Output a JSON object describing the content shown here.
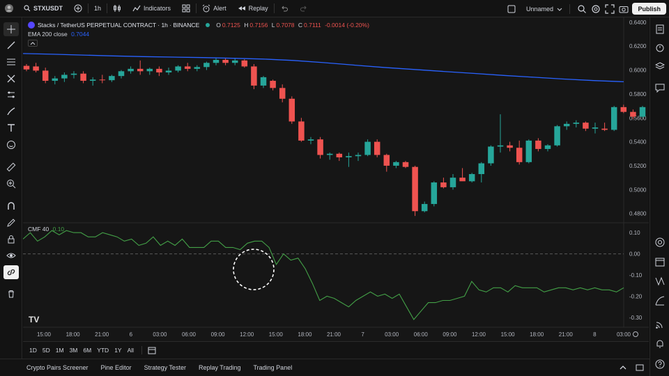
{
  "toolbar": {
    "symbol": "STXUSDT",
    "interval": "1h",
    "indicators_label": "Indicators",
    "alert_label": "Alert",
    "replay_label": "Replay",
    "layout_name": "Unnamed",
    "publish_label": "Publish"
  },
  "legend": {
    "title": "Stacks / TetherUS PERPETUAL CONTRACT · 1h · BINANCE",
    "o_label": "O",
    "o_value": "0.7125",
    "h_label": "H",
    "h_value": "0.7156",
    "l_label": "L",
    "l_value": "0.7078",
    "c_label": "C",
    "c_value": "0.7111",
    "change": "-0.0014 (-0.20%)",
    "ema_label": "EMA 200 close",
    "ema_value": "0.7044",
    "cmf_label": "CMF 40",
    "cmf_value": "0.10"
  },
  "colors": {
    "up": "#26a69a",
    "down": "#ef5350",
    "ema": "#2962ff",
    "cmf": "#43a047",
    "background": "#161616"
  },
  "range_buttons": [
    "1D",
    "5D",
    "1M",
    "3M",
    "6M",
    "YTD",
    "1Y",
    "All"
  ],
  "bottom_tabs": [
    "Crypto Pairs Screener",
    "Pine Editor",
    "Strategy Tester",
    "Replay Trading",
    "Trading Panel"
  ],
  "chart_data": {
    "type": "candlestick",
    "price_axis_ticks": [
      "0.6400",
      "0.6200",
      "0.6000",
      "0.5800",
      "0.5600",
      "0.5400",
      "0.5200",
      "0.5000",
      "0.4800"
    ],
    "price_ylim": [
      0.474,
      0.644
    ],
    "cmf_axis_ticks": [
      "0.10",
      "0.00",
      "-0.10",
      "-0.20",
      "-0.30"
    ],
    "cmf_ylim": [
      -0.33,
      0.13
    ],
    "time_ticks": [
      "15:00",
      "18:00",
      "21:00",
      "6",
      "03:00",
      "06:00",
      "09:00",
      "12:00",
      "15:00",
      "18:00",
      "21:00",
      "7",
      "03:00",
      "06:00",
      "09:00",
      "12:00",
      "15:00",
      "18:00",
      "21:00",
      "8",
      "03:00"
    ],
    "candles": [
      [
        0.6035,
        0.605,
        0.599,
        0.6005
      ],
      [
        0.603,
        0.606,
        0.598,
        0.5995
      ],
      [
        0.5995,
        0.602,
        0.589,
        0.591
      ],
      [
        0.591,
        0.595,
        0.588,
        0.593
      ],
      [
        0.593,
        0.598,
        0.59,
        0.596
      ],
      [
        0.596,
        0.599,
        0.593,
        0.597
      ],
      [
        0.597,
        0.599,
        0.589,
        0.591
      ],
      [
        0.591,
        0.594,
        0.587,
        0.592
      ],
      [
        0.592,
        0.596,
        0.589,
        0.5915
      ],
      [
        0.5915,
        0.596,
        0.59,
        0.595
      ],
      [
        0.595,
        0.6,
        0.593,
        0.599
      ],
      [
        0.599,
        0.603,
        0.597,
        0.601
      ],
      [
        0.601,
        0.608,
        0.596,
        0.599
      ],
      [
        0.599,
        0.602,
        0.596,
        0.601
      ],
      [
        0.601,
        0.603,
        0.595,
        0.598
      ],
      [
        0.598,
        0.602,
        0.596,
        0.5995
      ],
      [
        0.5995,
        0.604,
        0.598,
        0.603
      ],
      [
        0.603,
        0.606,
        0.599,
        0.601
      ],
      [
        0.601,
        0.604,
        0.599,
        0.6025
      ],
      [
        0.6025,
        0.607,
        0.6,
        0.606
      ],
      [
        0.606,
        0.61,
        0.604,
        0.6085
      ],
      [
        0.6085,
        0.61,
        0.604,
        0.606
      ],
      [
        0.606,
        0.6095,
        0.604,
        0.608
      ],
      [
        0.608,
        0.609,
        0.602,
        0.603
      ],
      [
        0.603,
        0.605,
        0.584,
        0.587
      ],
      [
        0.587,
        0.595,
        0.585,
        0.594
      ],
      [
        0.591,
        0.592,
        0.583,
        0.585
      ],
      [
        0.585,
        0.588,
        0.573,
        0.576
      ],
      [
        0.576,
        0.578,
        0.555,
        0.557
      ],
      [
        0.557,
        0.56,
        0.54,
        0.541
      ],
      [
        0.541,
        0.544,
        0.538,
        0.542
      ],
      [
        0.542,
        0.544,
        0.526,
        0.529
      ],
      [
        0.529,
        0.531,
        0.525,
        0.53
      ],
      [
        0.53,
        0.531,
        0.524,
        0.527
      ],
      [
        0.527,
        0.531,
        0.519,
        0.528
      ],
      [
        0.528,
        0.531,
        0.524,
        0.529
      ],
      [
        0.529,
        0.542,
        0.528,
        0.54
      ],
      [
        0.54,
        0.542,
        0.527,
        0.529
      ],
      [
        0.529,
        0.53,
        0.515,
        0.52
      ],
      [
        0.52,
        0.524,
        0.518,
        0.523
      ],
      [
        0.523,
        0.524,
        0.518,
        0.519
      ],
      [
        0.519,
        0.52,
        0.478,
        0.482
      ],
      [
        0.482,
        0.49,
        0.481,
        0.488
      ],
      [
        0.488,
        0.507,
        0.486,
        0.506
      ],
      [
        0.506,
        0.51,
        0.501,
        0.502
      ],
      [
        0.502,
        0.513,
        0.5,
        0.51
      ],
      [
        0.51,
        0.518,
        0.508,
        0.507
      ],
      [
        0.507,
        0.514,
        0.506,
        0.513
      ],
      [
        0.513,
        0.523,
        0.506,
        0.522
      ],
      [
        0.522,
        0.537,
        0.52,
        0.536
      ],
      [
        0.536,
        0.563,
        0.531,
        0.537
      ],
      [
        0.537,
        0.54,
        0.532,
        0.535
      ],
      [
        0.535,
        0.541,
        0.521,
        0.523
      ],
      [
        0.523,
        0.542,
        0.522,
        0.541
      ],
      [
        0.541,
        0.543,
        0.532,
        0.534
      ],
      [
        0.534,
        0.538,
        0.532,
        0.537
      ],
      [
        0.537,
        0.554,
        0.536,
        0.553
      ],
      [
        0.553,
        0.557,
        0.55,
        0.555
      ],
      [
        0.555,
        0.558,
        0.552,
        0.556
      ],
      [
        0.556,
        0.557,
        0.549,
        0.551
      ],
      [
        0.551,
        0.556,
        0.547,
        0.552
      ],
      [
        0.551,
        0.556,
        0.549,
        0.55
      ],
      [
        0.55,
        0.57,
        0.549,
        0.569
      ],
      [
        0.569,
        0.571,
        0.564,
        0.565
      ],
      [
        0.565,
        0.567,
        0.559,
        0.561
      ],
      [
        0.561,
        0.57,
        0.56,
        0.569
      ]
    ],
    "ema": [
      0.6138,
      0.6132,
      0.6125,
      0.6118,
      0.6112,
      0.6108,
      0.6104,
      0.6098,
      0.6092,
      0.608,
      0.6062,
      0.6042,
      0.6022,
      0.6005,
      0.5988,
      0.5972,
      0.5955,
      0.594,
      0.5925,
      0.5912,
      0.5902
    ],
    "cmf": [
      0.07,
      0.1,
      0.06,
      0.08,
      0.11,
      0.09,
      0.11,
      0.1,
      0.1,
      0.08,
      0.08,
      0.1,
      0.09,
      0.08,
      0.06,
      0.07,
      0.04,
      0.05,
      0.08,
      0.04,
      0.06,
      0.04,
      0.07,
      0.03,
      0.03,
      0.03,
      0.06,
      0.06,
      0.03,
      0.03,
      0.02,
      0.05,
      0.06,
      0.06,
      0.03,
      -0.05,
      0.0,
      -0.03,
      -0.02,
      -0.07,
      -0.14,
      -0.22,
      -0.2,
      -0.21,
      -0.23,
      -0.25,
      -0.22,
      -0.2,
      -0.18,
      -0.2,
      -0.19,
      -0.21,
      -0.19,
      -0.25,
      -0.31,
      -0.27,
      -0.23,
      -0.23,
      -0.22,
      -0.22,
      -0.21,
      -0.2,
      -0.13,
      -0.17,
      -0.18,
      -0.16,
      -0.16,
      -0.18,
      -0.15,
      -0.16,
      -0.16,
      -0.16,
      -0.18,
      -0.17,
      -0.16,
      -0.16,
      -0.17,
      -0.16,
      -0.17,
      -0.16,
      -0.17,
      -0.17,
      -0.18,
      -0.16
    ]
  }
}
